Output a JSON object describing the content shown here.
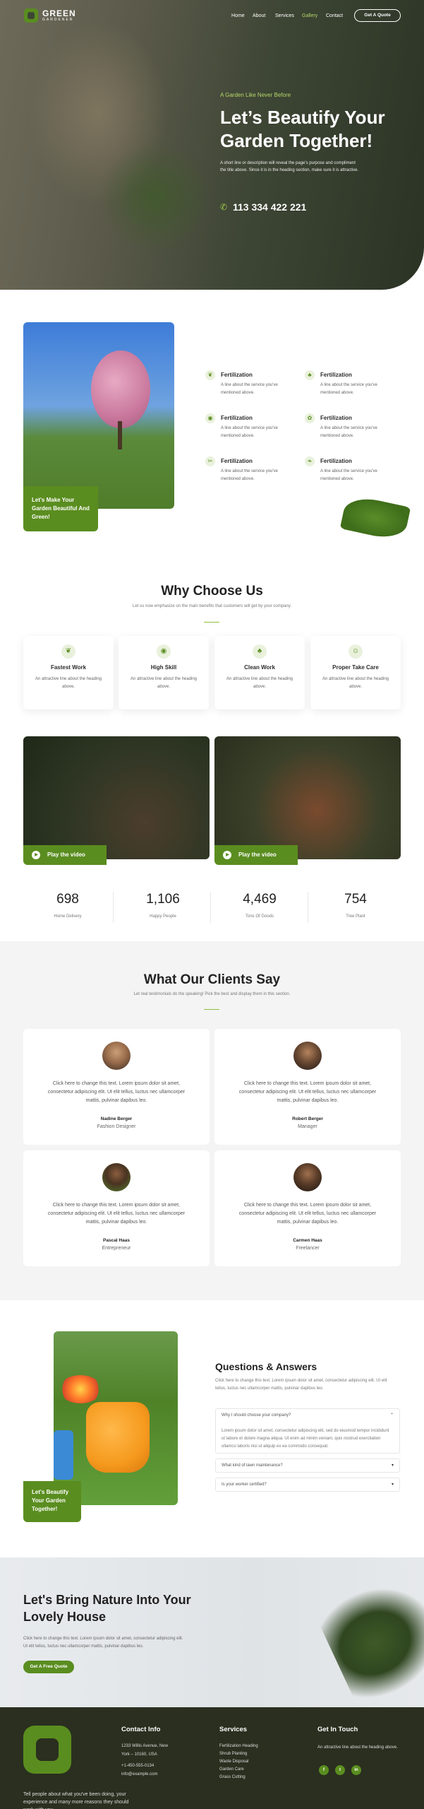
{
  "brand": {
    "name": "GREEN",
    "tag": "GARDENER"
  },
  "nav": {
    "items": [
      "Home",
      "About",
      "Services",
      "Gallery",
      "Contact"
    ],
    "active": "Gallery",
    "cta": "Get A Quote"
  },
  "hero": {
    "kicker": "A Garden Like Never Before",
    "title": "Let’s Beautify Your Garden Together!",
    "desc": "A short line or description will reveal the page's purpose and compliment the title above. Since it is in the heading section, make sure it is attractive.",
    "phone": "113 334 422 221"
  },
  "features": {
    "image_label": "Let's Make Your Garden Beautiful And Green!",
    "items": [
      {
        "icon": "leaf-icon",
        "title": "Fertilization",
        "desc": "A line about the service you've mentioned above."
      },
      {
        "icon": "sprout-icon",
        "title": "Fertilization",
        "desc": "A line about the service you've mentioned above."
      },
      {
        "icon": "eye-leaf-icon",
        "title": "Fertilization",
        "desc": "A line about the service you've mentioned above."
      },
      {
        "icon": "flower-icon",
        "title": "Fertilization",
        "desc": "A line about the service you've mentioned above."
      },
      {
        "icon": "scissors-icon",
        "title": "Fertilization",
        "desc": "A line about the service you've mentioned above."
      },
      {
        "icon": "leaves-icon",
        "title": "Fertilization",
        "desc": "A line about the service you've mentioned above."
      }
    ]
  },
  "why": {
    "title": "Why Choose Us",
    "subtitle": "Let us now emphasize on the main benefits that customers will get by your company.",
    "cards": [
      {
        "title": "Fastest Work",
        "desc": "An attractive line about the heading above."
      },
      {
        "title": "High Skill",
        "desc": "An attractive line about the heading above."
      },
      {
        "title": "Clean Work",
        "desc": "An attractive line about the heading above."
      },
      {
        "title": "Proper Take Care",
        "desc": "An attractive line about the heading above."
      }
    ]
  },
  "videos": {
    "play_label": "Play the video"
  },
  "stats": [
    {
      "value": "698",
      "label": "Home Delivery"
    },
    {
      "value": "1,106",
      "label": "Happy People"
    },
    {
      "value": "4,469",
      "label": "Tons Of Goods"
    },
    {
      "value": "754",
      "label": "Tree Plant"
    }
  ],
  "testimonials": {
    "title": "What Our Clients Say",
    "subtitle": "Let real testimonials do the speaking! Pick the best and display them in this section.",
    "items": [
      {
        "quote": "Click here to change this text. Lorem ipsum dolor sit amet, consectetur adipiscing elit. Ut elit tellus, luctus nec ullamcorper mattis, pulvinar dapibus leo.",
        "name": "Nadine Berger",
        "role": "Fashion Designer"
      },
      {
        "quote": "Click here to change this text. Lorem ipsum dolor sit amet, consectetur adipiscing elit. Ut elit tellus, luctus nec ullamcorper mattis, pulvinar dapibus leo.",
        "name": "Robert Berger",
        "role": "Manager"
      },
      {
        "quote": "Click here to change this text. Lorem ipsum dolor sit amet, consectetur adipiscing elit. Ut elit tellus, luctus nec ullamcorper mattis, pulvinar dapibus leo.",
        "name": "Pascal Haas",
        "role": "Entrepreneur"
      },
      {
        "quote": "Click here to change this text. Lorem ipsum dolor sit amet, consectetur adipiscing elit. Ut elit tellus, luctus nec ullamcorper mattis, pulvinar dapibus leo.",
        "name": "Carmen Haas",
        "role": "Freelancer"
      }
    ]
  },
  "faq": {
    "image_label": "Let's Beautify Your Garden Together!",
    "title": "Questions & Answers",
    "intro": "Click here to change this text. Lorem ipsum dolor sit amet, consectetur adipiscing elit. Ut elit tellus, luctus nec ullamcorper mattis, pulvinar dapibus leo.",
    "items": [
      {
        "q": "Why I should choose your company?",
        "a": "Lorem ipsum dolor sit amet, consectetur adipiscing elit, sed do eiusmod tempor incididunt ut labore et dolore magna aliqua. Ut enim ad minim veniam, quis nostrud exercitation ullamco laboris nisi ut aliquip ex ea commodo consequat.",
        "open": true
      },
      {
        "q": "What kind of lawn maintenance?",
        "open": false
      },
      {
        "q": "Is your worker certified?",
        "open": false
      }
    ]
  },
  "cta": {
    "title": "Let's Bring Nature Into Your Lovely House",
    "desc": "Click here to change this text. Lorem ipsum dolor sit amet, consectetur adipiscing elit. Ut elit tellus, luctus nec ullamcorper mattis, pulvinar dapibus leo.",
    "button": "Get A Free Quote"
  },
  "footer": {
    "about": "Tell people about what you've been doing, your experience and many more reasons they should work with you.",
    "contact": {
      "title": "Contact Info",
      "lines": [
        "1233 Willis Avenue, New",
        "York – 10160, USA",
        "+1-450-555-0134",
        "info@example.com"
      ]
    },
    "services": {
      "title": "Services",
      "lines": [
        "Fertilization Heading",
        "Shrub Planting",
        "Waste Disposal",
        "Garden Care",
        "Grass Cutting"
      ]
    },
    "touch": {
      "title": "Get In Touch",
      "desc": "An attractive line about the heading above.",
      "socials": [
        "f",
        "t",
        "in"
      ]
    }
  },
  "colors": {
    "accent": "#5a8d1f",
    "dark": "#2a2f1f",
    "lightbg": "#f4f4f4"
  }
}
